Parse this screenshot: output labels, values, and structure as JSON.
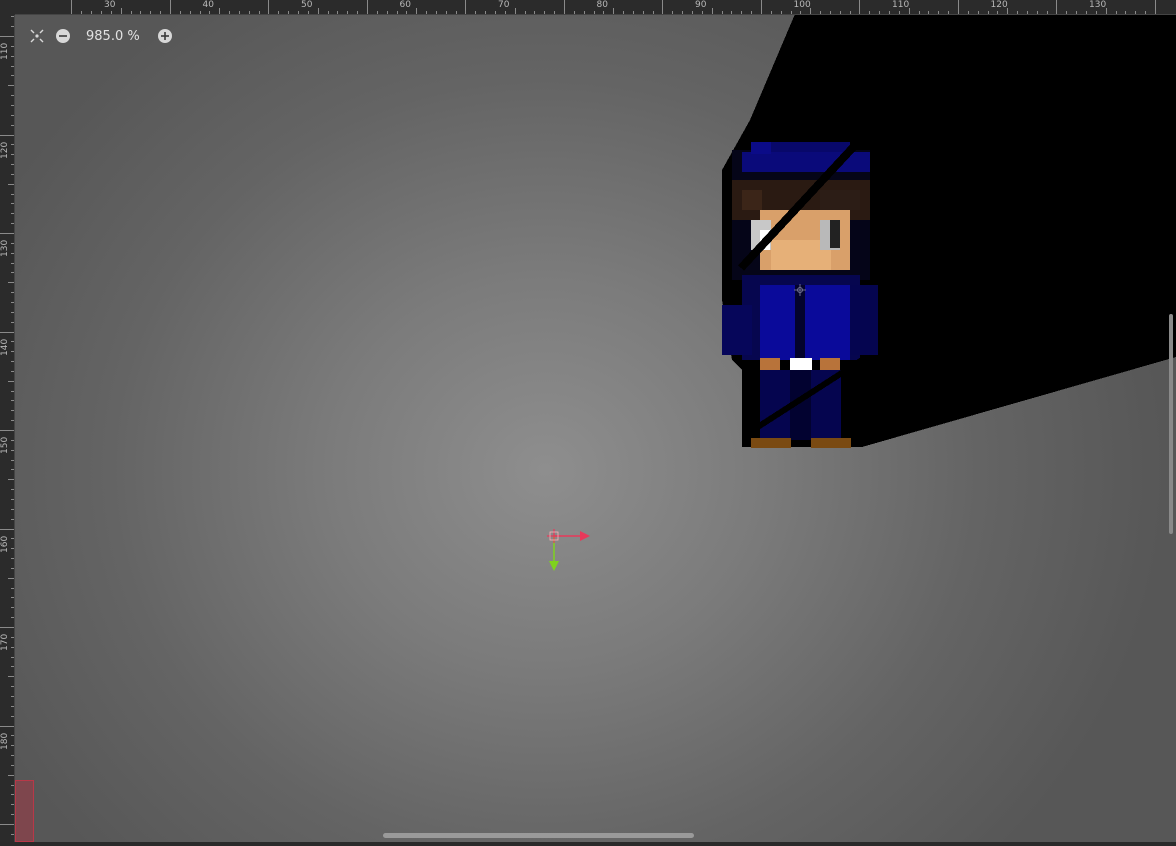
{
  "toolbar": {
    "zoom_label": "985.0 %",
    "icons": [
      "center-view-icon",
      "zoom-out-icon",
      "zoom-in-icon"
    ]
  },
  "ruler_top": {
    "labels": [
      "30",
      "40",
      "50",
      "60",
      "70",
      "80",
      "90",
      "100",
      "110",
      "120",
      "130"
    ]
  },
  "ruler_left": {
    "labels": [
      "110",
      "120",
      "130",
      "140",
      "150",
      "160",
      "170",
      "180"
    ]
  },
  "colors": {
    "x_axis": "#e8395a",
    "y_axis": "#7fd21e",
    "shadow": "#000000",
    "uniform": "#0a0a8a"
  }
}
